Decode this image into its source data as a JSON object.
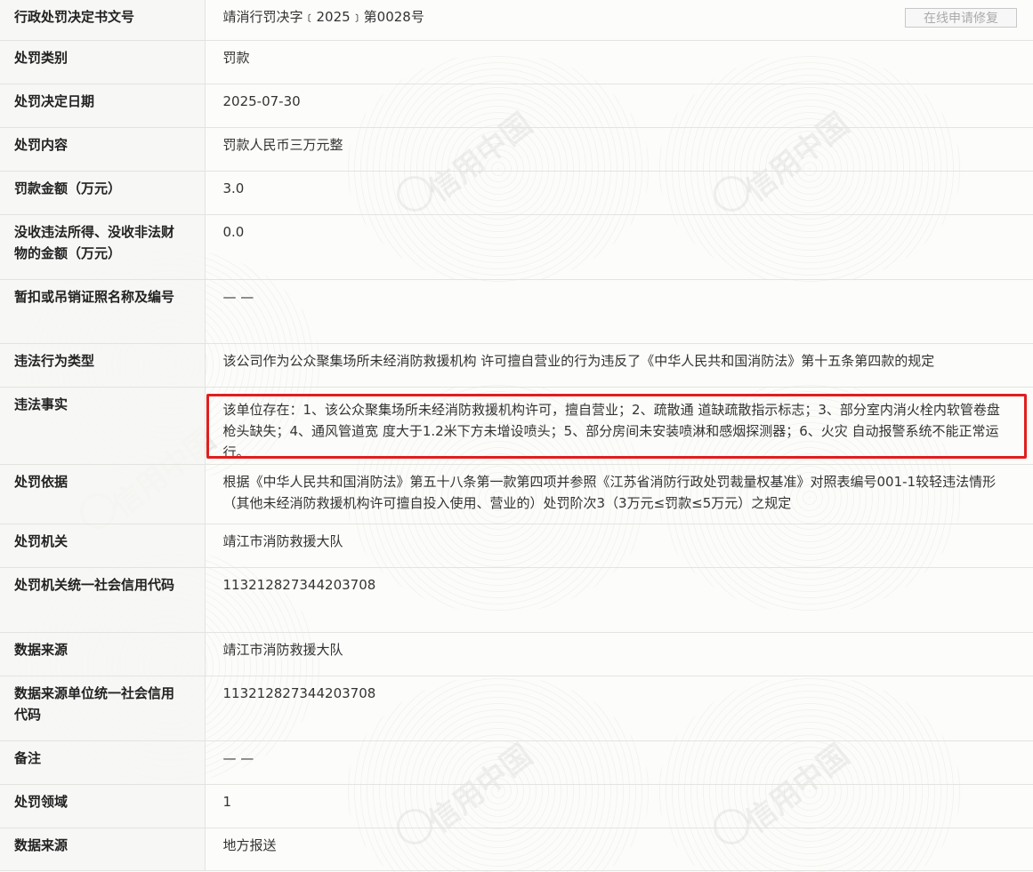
{
  "edit_button": "在线申请修复",
  "rows": [
    {
      "label": "行政处罚决定书文号",
      "value": "靖消行罚决字﹝2025﹞第0028号"
    },
    {
      "label": "处罚类别",
      "value": "罚款"
    },
    {
      "label": "处罚决定日期",
      "value": "2025-07-30"
    },
    {
      "label": "处罚内容",
      "value": "罚款人民币三万元整"
    },
    {
      "label": "罚款金额（万元）",
      "value": "3.0"
    },
    {
      "label": "没收违法所得、没收非法财物的金额（万元）",
      "value": "0.0"
    },
    {
      "label": "暂扣或吊销证照名称及编号",
      "value": "— —"
    },
    {
      "label": "违法行为类型",
      "value": "该公司作为公众聚集场所未经消防救援机构 许可擅自营业的行为违反了《中华人民共和国消防法》第十五条第四款的规定"
    },
    {
      "label": "违法事实",
      "value": "该单位存在：1、该公众聚集场所未经消防救援机构许可，擅自营业；2、疏散通 道缺疏散指示标志；3、部分室内消火栓内软管卷盘枪头缺失；4、通风管道宽 度大于1.2米下方未增设喷头；5、部分房间未安装喷淋和感烟探测器；6、火灾 自动报警系统不能正常运行。"
    },
    {
      "label": "处罚依据",
      "value": "根据《中华人民共和国消防法》第五十八条第一款第四项并参照《江苏省消防行政处罚裁量权基准》对照表编号001-1较轻违法情形（其他未经消防救援机构许可擅自投入使用、营业的）处罚阶次3（3万元≤罚款≤5万元）之规定"
    },
    {
      "label": "处罚机关",
      "value": "靖江市消防救援大队"
    },
    {
      "label": "处罚机关统一社会信用代码",
      "value": "113212827344203708"
    },
    {
      "label": "数据来源",
      "value": "靖江市消防救援大队"
    },
    {
      "label": "数据来源单位统一社会信用代码",
      "value": "113212827344203708"
    },
    {
      "label": "备注",
      "value": "— —"
    },
    {
      "label": "处罚领域",
      "value": "1"
    },
    {
      "label": "数据来源",
      "value": "地方报送"
    }
  ],
  "watermark_text": "信用中国",
  "colors": {
    "highlight": "#e01e1e",
    "border": "#e3e3e0"
  }
}
